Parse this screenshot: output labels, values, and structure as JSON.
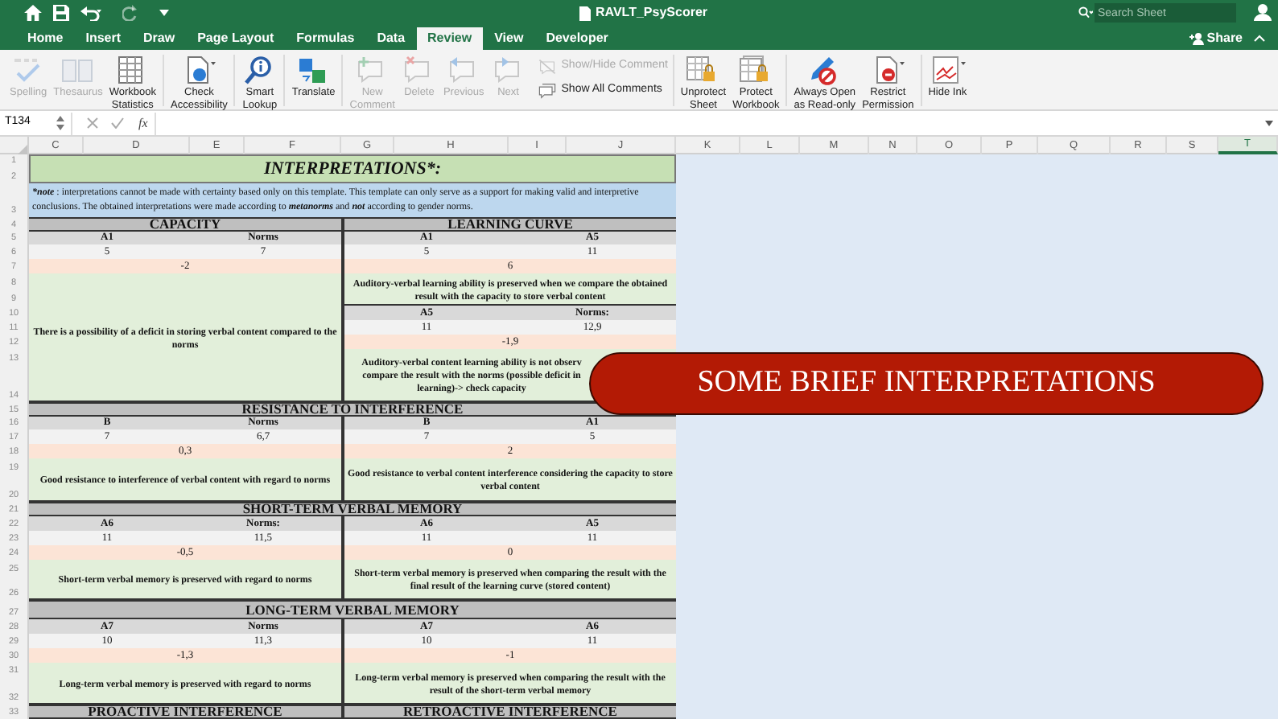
{
  "window": {
    "title": "RAVLT_PsyScorer"
  },
  "search": {
    "placeholder": "Search Sheet"
  },
  "share": {
    "label": "Share"
  },
  "tabs": [
    {
      "label": "Home",
      "selected": false
    },
    {
      "label": "Insert",
      "selected": false
    },
    {
      "label": "Draw",
      "selected": false
    },
    {
      "label": "Page Layout",
      "selected": false
    },
    {
      "label": "Formulas",
      "selected": false
    },
    {
      "label": "Data",
      "selected": false
    },
    {
      "label": "Review",
      "selected": true
    },
    {
      "label": "View",
      "selected": false
    },
    {
      "label": "Developer",
      "selected": false
    }
  ],
  "ribbon": [
    {
      "items": [
        {
          "kind": "large",
          "label": [
            "Spelling"
          ],
          "disabled": true
        },
        {
          "kind": "large",
          "label": [
            "Thesaurus"
          ],
          "disabled": true
        },
        {
          "kind": "large",
          "label": [
            "Workbook",
            "Statistics"
          ],
          "disabled": false
        }
      ]
    },
    {
      "items": [
        {
          "kind": "large",
          "label": [
            "Check",
            "Accessibility"
          ],
          "disabled": false
        }
      ]
    },
    {
      "items": [
        {
          "kind": "large",
          "label": [
            "Smart",
            "Lookup"
          ],
          "disabled": false
        }
      ]
    },
    {
      "items": [
        {
          "kind": "large",
          "label": [
            "Translate"
          ],
          "disabled": false
        }
      ]
    },
    {
      "items": [
        {
          "kind": "large",
          "label": [
            "New",
            "Comment"
          ],
          "disabled": true
        },
        {
          "kind": "large",
          "label": [
            "Delete"
          ],
          "disabled": true
        },
        {
          "kind": "large",
          "label": [
            "Previous"
          ],
          "disabled": true
        },
        {
          "kind": "large",
          "label": [
            "Next"
          ],
          "disabled": true
        },
        {
          "kind": "small",
          "label": [
            "Show/Hide Comment"
          ],
          "disabled": true
        },
        {
          "kind": "small",
          "label": [
            "Show All Comments"
          ],
          "disabled": false
        }
      ]
    },
    {
      "items": [
        {
          "kind": "large",
          "label": [
            "Unprotect",
            "Sheet"
          ],
          "disabled": false
        },
        {
          "kind": "large",
          "label": [
            "Protect",
            "Workbook"
          ],
          "disabled": false
        }
      ]
    },
    {
      "items": [
        {
          "kind": "large",
          "label": [
            "Always Open",
            "as Read-only"
          ],
          "disabled": false
        },
        {
          "kind": "large",
          "label": [
            "Restrict",
            "Permission"
          ],
          "disabled": false
        }
      ]
    },
    {
      "items": [
        {
          "kind": "large",
          "label": [
            "Hide Ink"
          ],
          "disabled": false
        }
      ]
    }
  ],
  "formula_bar": {
    "name_box": "T134",
    "function_label": "fx"
  },
  "columns": [
    {
      "label": "C",
      "selected": false
    },
    {
      "label": "D",
      "selected": false
    },
    {
      "label": "E",
      "selected": false
    },
    {
      "label": "F",
      "selected": false
    },
    {
      "label": "G",
      "selected": false
    },
    {
      "label": "H",
      "selected": false
    },
    {
      "label": "I",
      "selected": false
    },
    {
      "label": "J",
      "selected": false
    },
    {
      "label": "K",
      "selected": false
    },
    {
      "label": "L",
      "selected": false
    },
    {
      "label": "M",
      "selected": false
    },
    {
      "label": "N",
      "selected": false
    },
    {
      "label": "O",
      "selected": false
    },
    {
      "label": "P",
      "selected": false
    },
    {
      "label": "Q",
      "selected": false
    },
    {
      "label": "R",
      "selected": false
    },
    {
      "label": "S",
      "selected": false
    },
    {
      "label": "T",
      "selected": true
    }
  ],
  "row_numbers": [
    "1",
    "2",
    "3",
    "4",
    "5",
    "6",
    "7",
    "8",
    "9",
    "10",
    "11",
    "12",
    "13",
    "14",
    "15",
    "16",
    "17",
    "18",
    "19",
    "20",
    "21",
    "22",
    "23",
    "24",
    "25",
    "26",
    "27",
    "28",
    "29",
    "30",
    "31",
    "32",
    "33"
  ],
  "cells": [
    {
      "kind": "title",
      "text": "INTERPRETATIONS*:"
    },
    {
      "kind": "note",
      "segments": [
        {
          "text": "*note",
          "emphasis": true
        },
        {
          "text": " : interpretations cannot be made with certainty based only on this template. This template can only serve as a support for making valid and interpretive conclusions. The obtained interpretations were made according to ",
          "emphasis": false
        },
        {
          "text": "metanorms",
          "emphasis": true
        },
        {
          "text": " and ",
          "emphasis": false
        },
        {
          "text": "not",
          "emphasis": true
        },
        {
          "text": " according to gender norms.",
          "emphasis": false
        }
      ]
    },
    {
      "kind": "section",
      "text": "CAPACITY"
    },
    {
      "kind": "section",
      "text": "LEARNING CURVE"
    },
    {
      "kind": "header",
      "text": "A1"
    },
    {
      "kind": "header",
      "text": "Norms"
    },
    {
      "kind": "header",
      "text": "A1"
    },
    {
      "kind": "header",
      "text": "A5"
    },
    {
      "kind": "value",
      "text": "5"
    },
    {
      "kind": "value",
      "text": "7"
    },
    {
      "kind": "value",
      "text": "5"
    },
    {
      "kind": "value",
      "text": "11"
    },
    {
      "kind": "difference",
      "text": "-2"
    },
    {
      "kind": "difference",
      "text": "6"
    },
    {
      "kind": "conclusion",
      "text": "Auditory-verbal learning ability is preserved when we compare the obtained result with the capacity to store verbal content"
    },
    {
      "kind": "conclusion",
      "text": "There is a possibility of a deficit in storing verbal content compared to the norms"
    },
    {
      "kind": "header",
      "text": "A5"
    },
    {
      "kind": "header",
      "text": "Norms:"
    },
    {
      "kind": "value",
      "text": "11"
    },
    {
      "kind": "value",
      "text": "12,9"
    },
    {
      "kind": "difference",
      "text": "-1,9"
    },
    {
      "kind": "conclusion",
      "lines": [
        "Auditory-verbal content learning ability is not observ",
        "compare the result with the norms (possible deficit in",
        "learning)-> check capacity"
      ]
    },
    {
      "kind": "section",
      "text": "RESISTANCE TO INTERFERENCE"
    },
    {
      "kind": "header",
      "text": "B"
    },
    {
      "kind": "header",
      "text": "Norms"
    },
    {
      "kind": "header",
      "text": "B"
    },
    {
      "kind": "header",
      "text": "A1"
    },
    {
      "kind": "value",
      "text": "7"
    },
    {
      "kind": "value",
      "text": "6,7"
    },
    {
      "kind": "value",
      "text": "7"
    },
    {
      "kind": "value",
      "text": "5"
    },
    {
      "kind": "difference",
      "text": "0,3"
    },
    {
      "kind": "difference",
      "text": "2"
    },
    {
      "kind": "conclusion",
      "text": "Good resistance to interference of verbal content with regard to norms"
    },
    {
      "kind": "conclusion",
      "text": "Good resistance to verbal content interference considering the capacity to store verbal content"
    },
    {
      "kind": "section",
      "text": "SHORT-TERM VERBAL MEMORY"
    },
    {
      "kind": "header",
      "text": "A6"
    },
    {
      "kind": "header",
      "text": "Norms:"
    },
    {
      "kind": "header",
      "text": "A6"
    },
    {
      "kind": "header",
      "text": "A5"
    },
    {
      "kind": "value",
      "text": "11"
    },
    {
      "kind": "value",
      "text": "11,5"
    },
    {
      "kind": "value",
      "text": "11"
    },
    {
      "kind": "value",
      "text": "11"
    },
    {
      "kind": "difference",
      "text": "-0,5"
    },
    {
      "kind": "difference",
      "text": "0"
    },
    {
      "kind": "conclusion",
      "text": "Short-term verbal memory is preserved with regard to norms"
    },
    {
      "kind": "conclusion",
      "text": "Short-term verbal memory is preserved when comparing the result with the final result of the learning curve (stored content)"
    },
    {
      "kind": "section",
      "text": "LONG-TERM VERBAL MEMORY"
    },
    {
      "kind": "header",
      "text": "A7"
    },
    {
      "kind": "header",
      "text": "Norms"
    },
    {
      "kind": "header",
      "text": "A7"
    },
    {
      "kind": "header",
      "text": "A6"
    },
    {
      "kind": "value",
      "text": "10"
    },
    {
      "kind": "value",
      "text": "11,3"
    },
    {
      "kind": "value",
      "text": "10"
    },
    {
      "kind": "value",
      "text": "11"
    },
    {
      "kind": "difference",
      "text": "-1,3"
    },
    {
      "kind": "difference",
      "text": "-1"
    },
    {
      "kind": "conclusion",
      "text": "Long-term verbal memory is preserved with regard to norms"
    },
    {
      "kind": "conclusion",
      "text": "Long-term verbal memory is preserved when comparing the result with the result of the short-term verbal memory"
    },
    {
      "kind": "section",
      "text": "PROACTIVE INTERFERENCE"
    },
    {
      "kind": "section",
      "text": "RETROACTIVE INTERFERENCE"
    }
  ],
  "banner": {
    "text": "SOME BRIEF INTERPRETATIONS"
  }
}
